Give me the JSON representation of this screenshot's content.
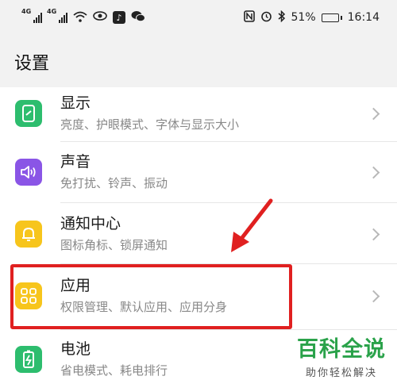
{
  "status_bar": {
    "signal_tag_1": "4G",
    "signal_tag_2": "4G",
    "battery_percent": "51%",
    "battery_level": 0.51,
    "time": "16:14",
    "icons": [
      "signal-4g-icon",
      "signal-4g-icon",
      "wifi-icon",
      "eye-icon",
      "tiktok-icon",
      "wechat-icon",
      "nfc-icon",
      "alarm-icon",
      "bluetooth-icon",
      "battery-icon"
    ]
  },
  "page": {
    "title": "设置"
  },
  "settings": [
    {
      "label": "显示",
      "subtitle": "亮度、护眼模式、字体与显示大小",
      "icon": "display-icon",
      "color": "#2dbd6e"
    },
    {
      "label": "声音",
      "subtitle": "免打扰、铃声、振动",
      "icon": "sound-icon",
      "color": "#8a55e6"
    },
    {
      "label": "通知中心",
      "subtitle": "图标角标、锁屏通知",
      "icon": "bell-icon",
      "color": "#f7c51c"
    },
    {
      "label": "应用",
      "subtitle": "权限管理、默认应用、应用分身",
      "icon": "apps-grid-icon",
      "color": "#f7c51c"
    },
    {
      "label": "电池",
      "subtitle": "省电模式、耗电排行",
      "icon": "battery-app-icon",
      "color": "#2dbd6e"
    }
  ],
  "watermark": {
    "title": "百科全说",
    "subtitle": "助你轻松解决"
  },
  "colors": {
    "highlight": "#e02020",
    "watermark_green": "#2aa24a"
  }
}
